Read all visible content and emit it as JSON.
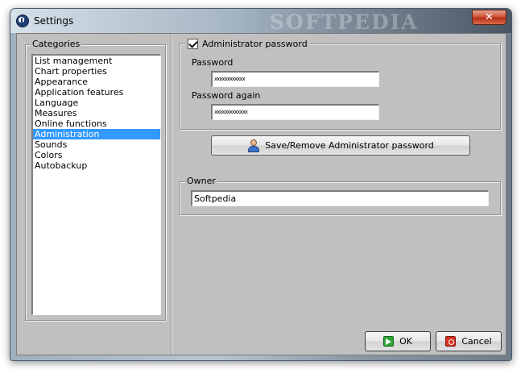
{
  "window": {
    "title": "Settings",
    "watermark": "SOFTPEDIA",
    "close_symbol": "✕",
    "app_icon": "app-logo-icon"
  },
  "categories": {
    "legend": "Categories",
    "items": [
      "List management",
      "Chart properties",
      "Appearance",
      "Application features",
      "Language",
      "Measures",
      "Online functions",
      "Administration",
      "Sounds",
      "Colors",
      "Autobackup"
    ],
    "selected": "Administration"
  },
  "admin": {
    "checkbox_label": "Administrator password",
    "checked": true,
    "password_label": "Password",
    "password_value": "xxxxxxxxxxxx",
    "password_again_label": "Password again",
    "password_again_value": "xxxxxxxxxxxxx",
    "save_button_label": "Save/Remove Administrator password",
    "save_button_icon": "user-icon"
  },
  "owner": {
    "legend": "Owner",
    "value": "Softpedia"
  },
  "buttons": {
    "ok_label": "OK",
    "ok_icon": "green-arrow-icon",
    "cancel_label": "Cancel",
    "cancel_icon": "red-power-icon"
  },
  "colors": {
    "selection": "#3399ff",
    "dialog_bg": "#c0c0c0",
    "close_button": "#c8432a"
  }
}
